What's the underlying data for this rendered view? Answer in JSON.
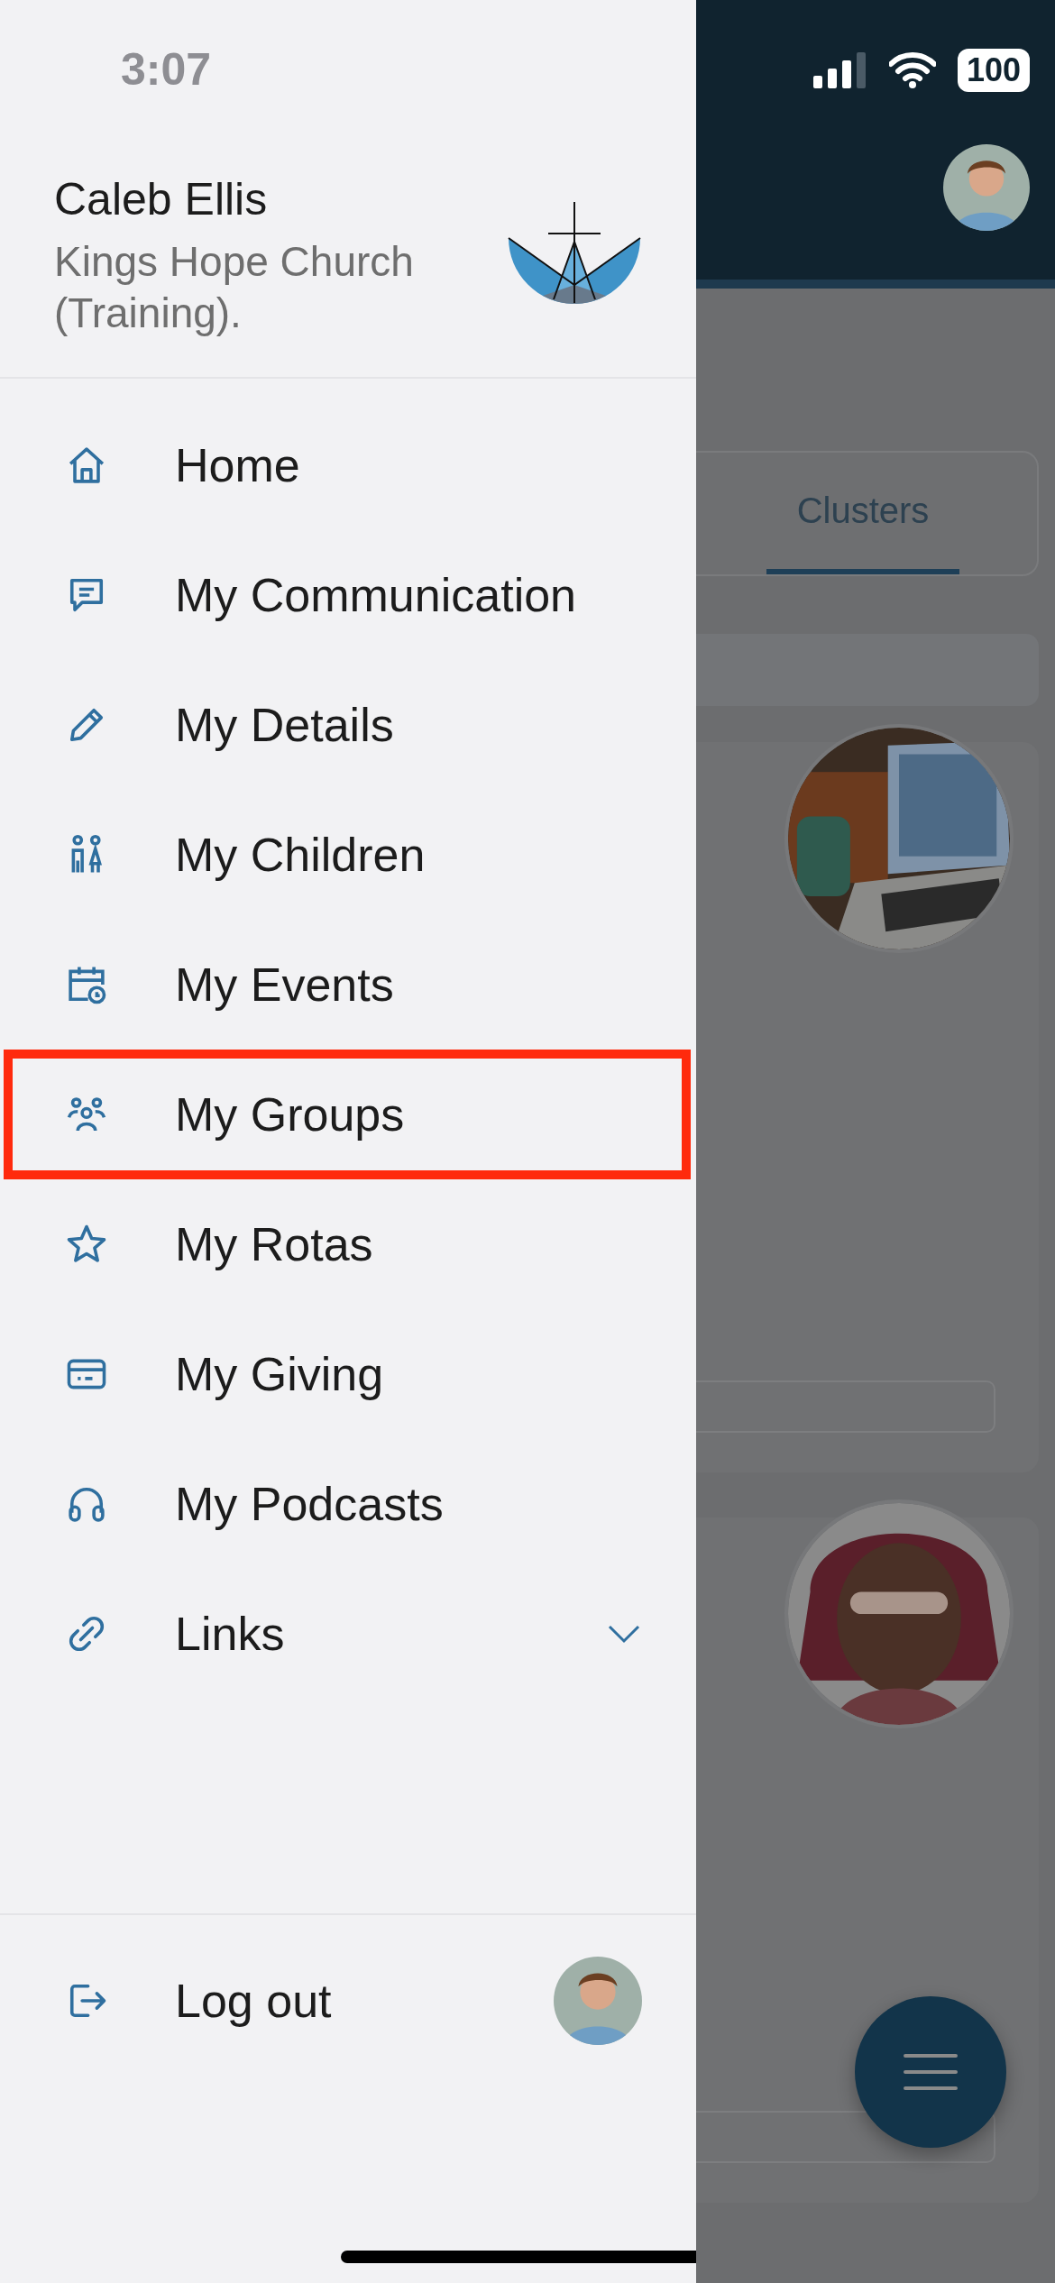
{
  "status_bar": {
    "time": "3:07",
    "battery": "100"
  },
  "profile": {
    "name": "Caleb Ellis",
    "organization": "Kings Hope Church (Training)."
  },
  "menu": [
    {
      "label": "Home",
      "kind": "home",
      "highlighted": false,
      "expandable": false
    },
    {
      "label": "My Communication",
      "kind": "chat",
      "highlighted": false,
      "expandable": false
    },
    {
      "label": "My Details",
      "kind": "pencil",
      "highlighted": false,
      "expandable": false
    },
    {
      "label": "My Children",
      "kind": "children",
      "highlighted": false,
      "expandable": false
    },
    {
      "label": "My Events",
      "kind": "calendar",
      "highlighted": false,
      "expandable": false
    },
    {
      "label": "My Groups",
      "kind": "group",
      "highlighted": true,
      "expandable": false
    },
    {
      "label": "My Rotas",
      "kind": "star",
      "highlighted": false,
      "expandable": false
    },
    {
      "label": "My Giving",
      "kind": "card",
      "highlighted": false,
      "expandable": false
    },
    {
      "label": "My Podcasts",
      "kind": "headphones",
      "highlighted": false,
      "expandable": false
    },
    {
      "label": "Links",
      "kind": "link",
      "highlighted": false,
      "expandable": true
    }
  ],
  "logout": {
    "label": "Log out"
  },
  "background_page": {
    "tabs": [
      {
        "label": "Clusters",
        "selected": true
      }
    ]
  }
}
